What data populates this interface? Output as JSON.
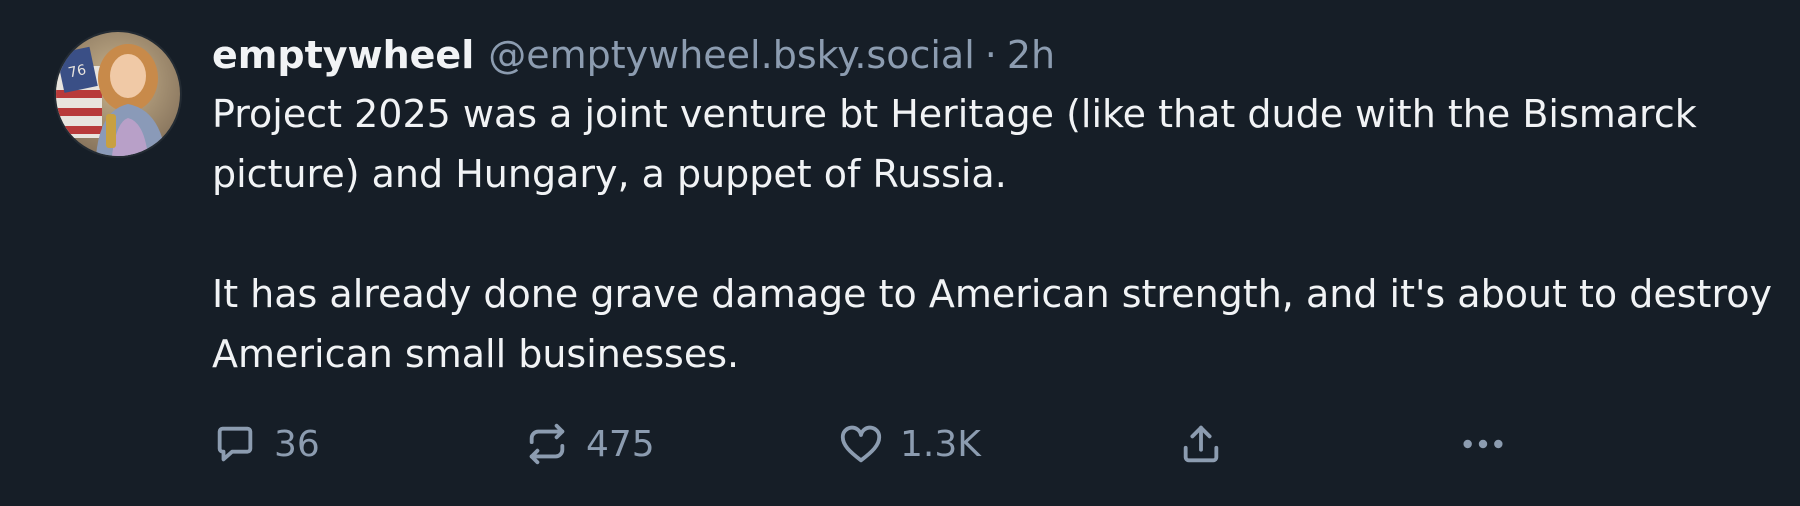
{
  "post": {
    "author": {
      "display_name": "emptywheel",
      "handle": "@emptywheel.bsky.social",
      "avatar_icon": "user-avatar-photo",
      "avatar_badge_text": "76"
    },
    "separator": "·",
    "timestamp": "2h",
    "paragraphs": [
      "Project 2025 was a joint venture bt Heritage (like that dude with the Bismarck picture) and Hungary, a puppet of Russia.",
      "It has already done grave damage to American strength, and it's about to destroy American small businesses."
    ],
    "actions": {
      "reply": {
        "icon": "comment-bubble-icon",
        "count": "36"
      },
      "repost": {
        "icon": "repost-arrows-icon",
        "count": "475"
      },
      "like": {
        "icon": "heart-icon",
        "count": "1.3K"
      },
      "share": {
        "icon": "share-upload-icon"
      },
      "more": {
        "icon": "ellipsis-icon"
      }
    }
  },
  "colors": {
    "background": "#161e27",
    "primary_text": "#f1f3f5",
    "secondary_text": "#8c9cb0"
  }
}
